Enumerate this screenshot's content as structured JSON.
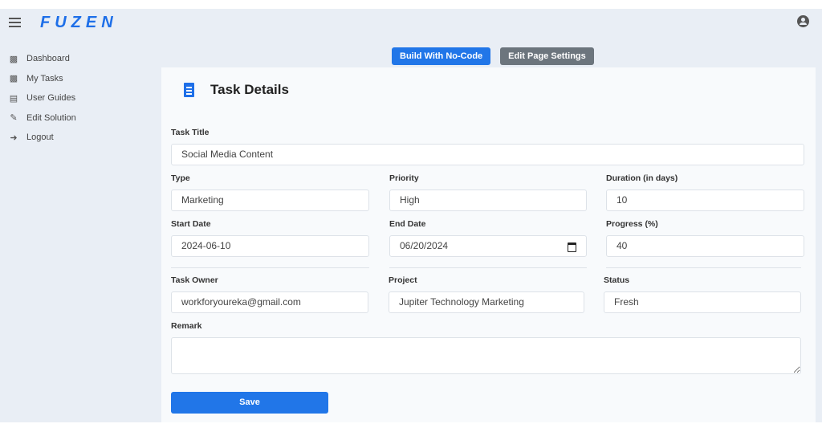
{
  "app": {
    "logo": "FUZEN"
  },
  "sidebar": {
    "items": [
      {
        "label": "Dashboard",
        "icon": "puzzle-icon"
      },
      {
        "label": "My Tasks",
        "icon": "puzzle-icon"
      },
      {
        "label": "User Guides",
        "icon": "book-icon"
      },
      {
        "label": "Edit Solution",
        "icon": "pencil-icon"
      },
      {
        "label": "Logout",
        "icon": "logout-icon"
      }
    ]
  },
  "toolbar": {
    "build_label": "Build With No-Code",
    "settings_label": "Edit Page Settings"
  },
  "form": {
    "title": "Task Details",
    "task_title": {
      "label": "Task Title",
      "value": "Social Media Content"
    },
    "type": {
      "label": "Type",
      "value": "Marketing"
    },
    "priority": {
      "label": "Priority",
      "value": "High"
    },
    "duration": {
      "label": "Duration (in days)",
      "value": "10"
    },
    "start_date": {
      "label": "Start Date",
      "value": "2024-06-10"
    },
    "end_date": {
      "label": "End Date",
      "value": "06/20/2024"
    },
    "progress": {
      "label": "Progress (%)",
      "value": "40"
    },
    "owner": {
      "label": "Task Owner",
      "value": "workforyoureka@gmail.com"
    },
    "project": {
      "label": "Project",
      "value": "Jupiter Technology Marketing"
    },
    "status": {
      "label": "Status",
      "value": "Fresh"
    },
    "remark": {
      "label": "Remark",
      "value": ""
    },
    "save_label": "Save"
  }
}
